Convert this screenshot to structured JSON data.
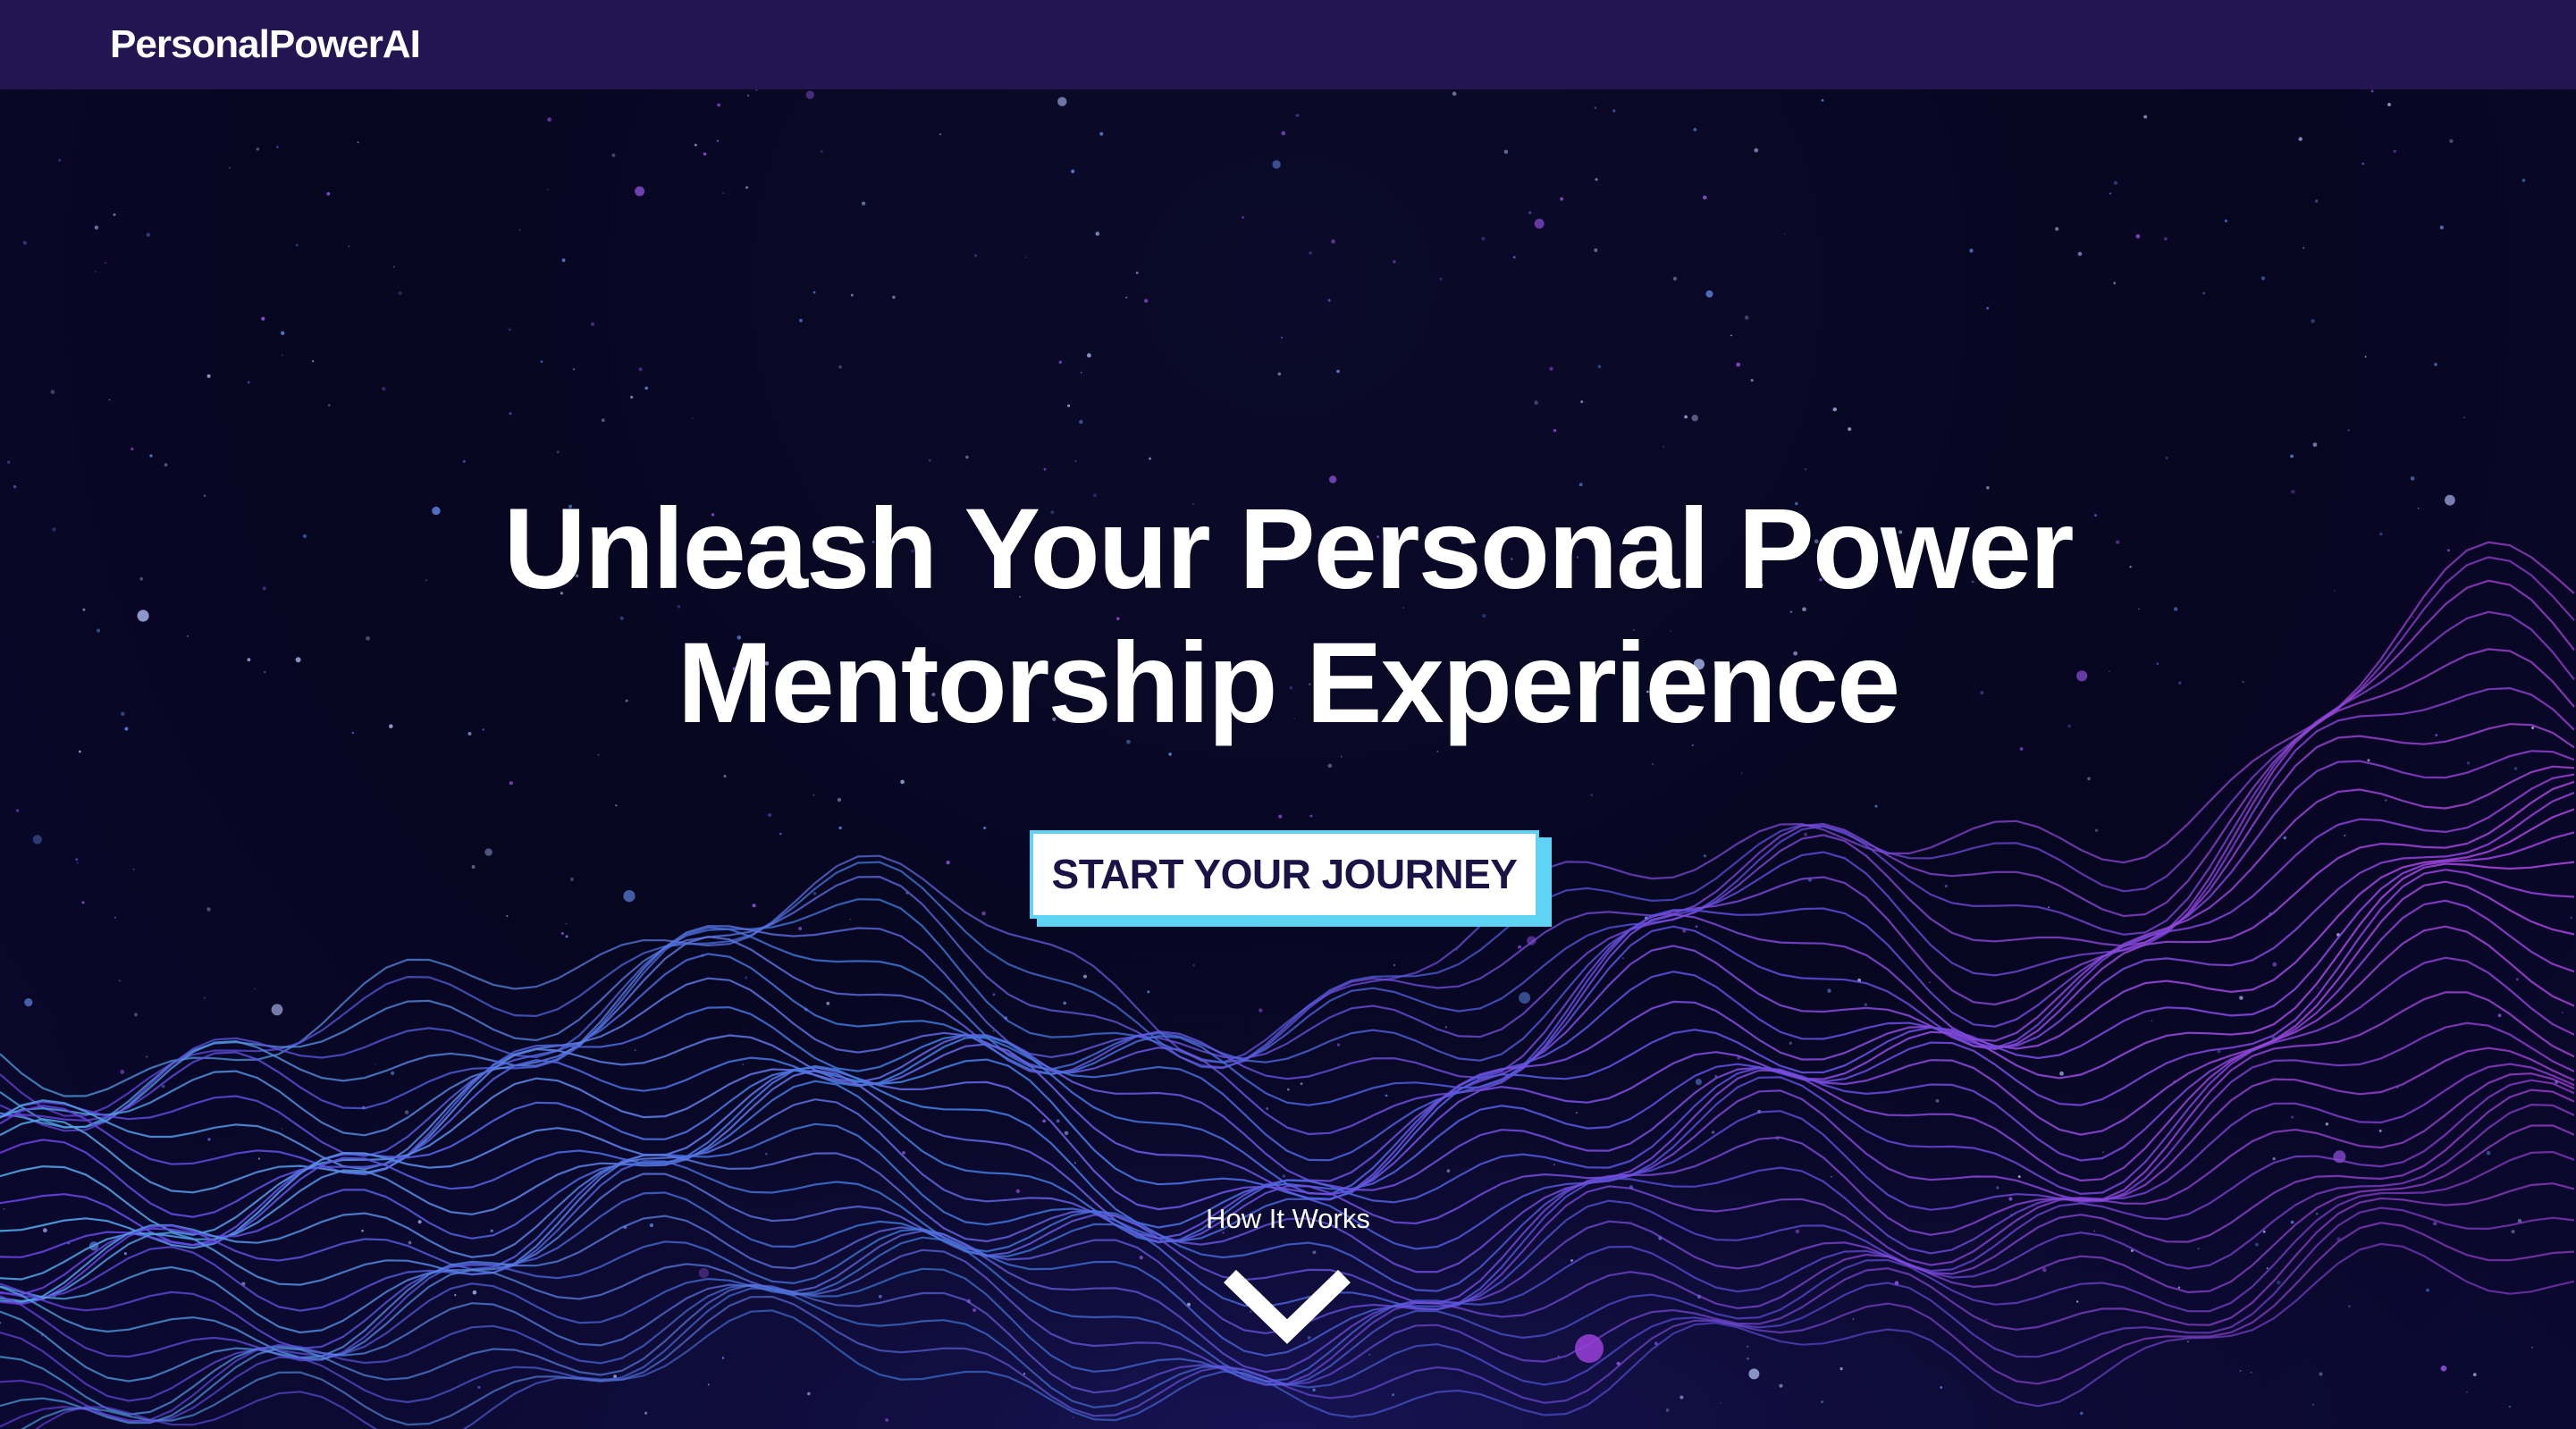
{
  "navbar": {
    "brand": "PersonalPowerAI"
  },
  "hero": {
    "title_line1": "Unleash Your Personal Power",
    "title_line2": "Mentorship Experience",
    "cta_label": "START YOUR JOURNEY",
    "how_it_works_label": "How It Works",
    "scroll_icon": "chevron-down-icon"
  },
  "colors": {
    "navbar_bg": "#221551",
    "page_bg": "#07061f",
    "cta_border": "#5fd3f3",
    "cta_text": "#1a1446",
    "wave_blue": "#3a6fd8",
    "wave_purple": "#8a3fd6"
  }
}
